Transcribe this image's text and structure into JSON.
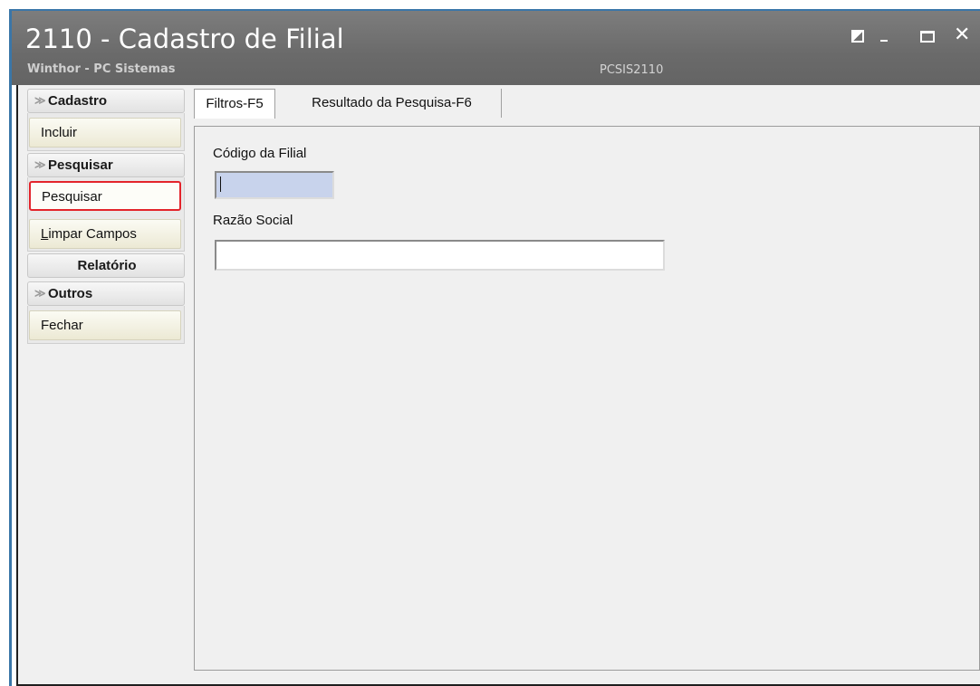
{
  "window": {
    "title": "2110 - Cadastro de Filial",
    "subtitle": "Winthor - PC Sistemas",
    "code": "PCSIS2110",
    "close_glyph": "✕"
  },
  "sidebar": {
    "groups": [
      {
        "label": "Cadastro",
        "chevron": "≫",
        "items": [
          {
            "label": "Incluir"
          }
        ]
      },
      {
        "label": "Pesquisar",
        "chevron": "≫",
        "items": [
          {
            "label": "Pesquisar",
            "active": true
          },
          {
            "label_underlined": "L",
            "label_rest": "impar Campos"
          }
        ]
      },
      {
        "label": "Relatório"
      },
      {
        "label": "Outros",
        "chevron": "≫",
        "items": [
          {
            "label": "Fechar"
          }
        ]
      }
    ]
  },
  "tabs": [
    {
      "label": "Filtros-F5",
      "selected": true
    },
    {
      "label": "Resultado da Pesquisa-F6",
      "selected": false
    }
  ],
  "filters": {
    "codigo_label": "Código da Filial",
    "codigo_value": "",
    "razao_label": "Razão Social",
    "razao_value": ""
  },
  "icons": [
    "restore-icon",
    "minimize-icon",
    "maximize-icon",
    "close-icon",
    "chevron-double-down-icon"
  ]
}
